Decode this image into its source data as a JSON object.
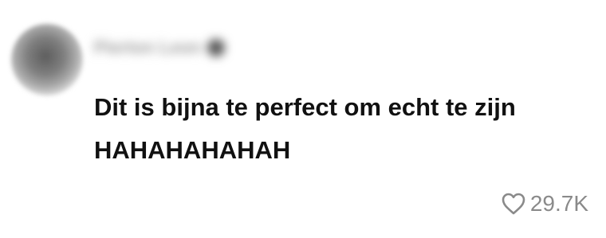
{
  "comment": {
    "username": "Pierton Leon",
    "text": "Dit is bijna te perfect om echt te zijn\nHAHAHAHAHAH",
    "likes": "29.7K",
    "icons": {
      "avatar": "user-avatar-blurred",
      "verified": "verified-badge-icon",
      "like": "heart-outline-icon"
    },
    "colors": {
      "text": "#111111",
      "muted": "#8a8a8a"
    }
  }
}
